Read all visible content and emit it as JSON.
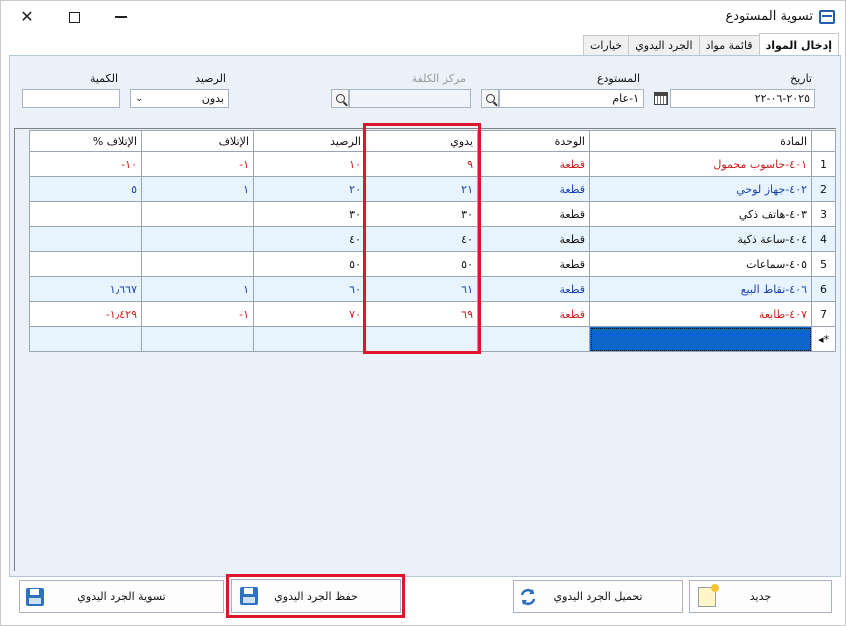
{
  "window": {
    "title": "تسوية المستودع"
  },
  "tabs": [
    {
      "label": "إدخال المواد"
    },
    {
      "label": "قائمة مواد"
    },
    {
      "label": "الجرد اليدوي"
    },
    {
      "label": "خيارات"
    }
  ],
  "form": {
    "date_label": "تاريخ",
    "date_value": "٢٠٢٥-٠٦-٢٢",
    "warehouse_label": "المستودع",
    "warehouse_value": "١-عام",
    "cost_center_label": "مركز الكلفة",
    "cost_center_value": "",
    "balance_label": "الرصيد",
    "balance_value": "بدون",
    "quantity_label": "الكمية",
    "quantity_value": ""
  },
  "grid": {
    "columns": [
      "المادة",
      "الوحدة",
      "يدوي",
      "الرصيد",
      "الإتلاف",
      "الإتلاف %"
    ],
    "rows": [
      {
        "num": "1",
        "item": "٤٠١-حاسوب محمول",
        "unit": "قطعة",
        "manual": "٩",
        "balance": "١٠",
        "damage": "١-",
        "damage_pct": "١٠-",
        "color": "red",
        "stripe": "white"
      },
      {
        "num": "2",
        "item": "٤٠٢-جهاز لوحي",
        "unit": "قطعة",
        "manual": "٢١",
        "balance": "٢٠",
        "damage": "١",
        "damage_pct": "٥",
        "color": "blue",
        "stripe": "blue"
      },
      {
        "num": "3",
        "item": "٤٠٣-هاتف ذكي",
        "unit": "قطعة",
        "manual": "٣٠",
        "balance": "٣٠",
        "damage": "",
        "damage_pct": "",
        "color": "black",
        "stripe": "white"
      },
      {
        "num": "4",
        "item": "٤٠٤-ساعة ذكية",
        "unit": "قطعة",
        "manual": "٤٠",
        "balance": "٤٠",
        "damage": "",
        "damage_pct": "",
        "color": "black",
        "stripe": "blue"
      },
      {
        "num": "5",
        "item": "٤٠٥-سماعات",
        "unit": "قطعة",
        "manual": "٥٠",
        "balance": "٥٠",
        "damage": "",
        "damage_pct": "",
        "color": "black",
        "stripe": "white"
      },
      {
        "num": "6",
        "item": "٤٠٦-نقاط البيع",
        "unit": "قطعة",
        "manual": "٦١",
        "balance": "٦٠",
        "damage": "١",
        "damage_pct": "١٫٦٦٧",
        "color": "blue",
        "stripe": "blue"
      },
      {
        "num": "7",
        "item": "٤٠٧-طابعة",
        "unit": "قطعة",
        "manual": "٦٩",
        "balance": "٧٠",
        "damage": "١-",
        "damage_pct": "١٫٤٢٩-",
        "color": "red",
        "stripe": "white"
      }
    ]
  },
  "buttons": {
    "new_label": "جديد",
    "load_label": "تحميل الجرد اليدوي",
    "save_label": "حفظ الجرد اليدوي",
    "settle_label": "تسوية الجرد اليدوي"
  },
  "colors": {
    "accent_blue": "#1a3fb3",
    "negative_red": "#d11c1c",
    "highlight": "#e0152d",
    "selected_cell": "#0c67c8"
  }
}
